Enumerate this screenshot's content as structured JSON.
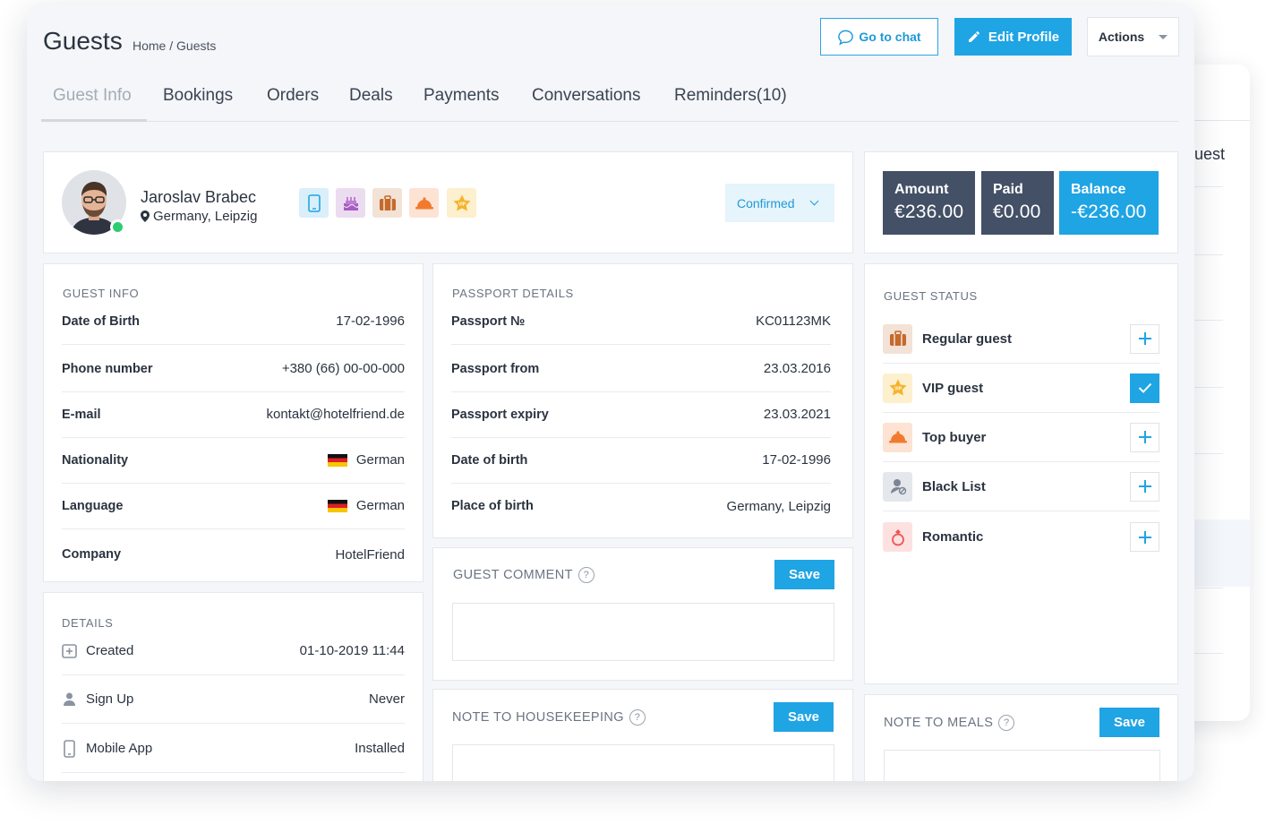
{
  "back_window": {
    "text": "uest"
  },
  "header": {
    "title": "Guests",
    "breadcrumb": "Home / Guests",
    "go_to_chat": "Go to chat",
    "edit_profile": "Edit Profile",
    "actions": "Actions"
  },
  "tabs": [
    {
      "label": "Guest Info"
    },
    {
      "label": "Bookings"
    },
    {
      "label": "Orders"
    },
    {
      "label": "Deals"
    },
    {
      "label": "Payments"
    },
    {
      "label": "Conversations"
    },
    {
      "label": "Reminders(10)"
    }
  ],
  "profile": {
    "name": "Jaroslav Brabec",
    "location": "Germany, Leipzig",
    "status": "Confirmed",
    "tags": [
      "mobile-icon",
      "birthday-cake-icon",
      "suitcase-icon",
      "food-cloche-icon",
      "vip-star-icon"
    ]
  },
  "balance": {
    "amount_label": "Amount",
    "amount_value": "€236.00",
    "paid_label": "Paid",
    "paid_value": "€0.00",
    "balance_label": "Balance",
    "balance_value": "-€236.00"
  },
  "guest_info": {
    "title": "GUEST INFO",
    "rows": [
      {
        "label": "Date of Birth",
        "value": "17-02-1996"
      },
      {
        "label": "Phone number",
        "value": "+380 (66) 00-00-000"
      },
      {
        "label": "E-mail",
        "value": "kontakt@hotelfriend.de"
      },
      {
        "label": "Nationality",
        "value": "German"
      },
      {
        "label": "Language",
        "value": "German"
      },
      {
        "label": "Company",
        "value": "HotelFriend"
      }
    ]
  },
  "details": {
    "title": "DETAILS",
    "rows": [
      {
        "label": "Created",
        "value": "01-10-2019 11:44"
      },
      {
        "label": "Sign Up",
        "value": "Never"
      },
      {
        "label": "Mobile App",
        "value": "Installed"
      }
    ]
  },
  "passport": {
    "title": "PASSPORT DETAILS",
    "rows": [
      {
        "label": "Passport №",
        "value": "KC01123MK"
      },
      {
        "label": "Passport from",
        "value": "23.03.2016"
      },
      {
        "label": "Passport expiry",
        "value": "23.03.2021"
      },
      {
        "label": "Date of birth",
        "value": "17-02-1996"
      },
      {
        "label": "Place of birth",
        "value": "Germany, Leipzig"
      }
    ]
  },
  "notes": {
    "guest_comment": "GUEST COMMENT",
    "housekeeping": "NOTE TO HOUSEKEEPING",
    "meals": "NOTE TO MEALS",
    "save": "Save",
    "help": "?"
  },
  "guest_status": {
    "title": "GUEST STATUS",
    "items": [
      {
        "label": "Regular guest",
        "checked": false
      },
      {
        "label": "VIP guest",
        "checked": true
      },
      {
        "label": "Top buyer",
        "checked": false
      },
      {
        "label": "Black List",
        "checked": false
      },
      {
        "label": "Romantic",
        "checked": false
      }
    ]
  },
  "colors": {
    "accent": "#1fa4e4",
    "dark_tile": "#435066",
    "online": "#2ecc71"
  }
}
